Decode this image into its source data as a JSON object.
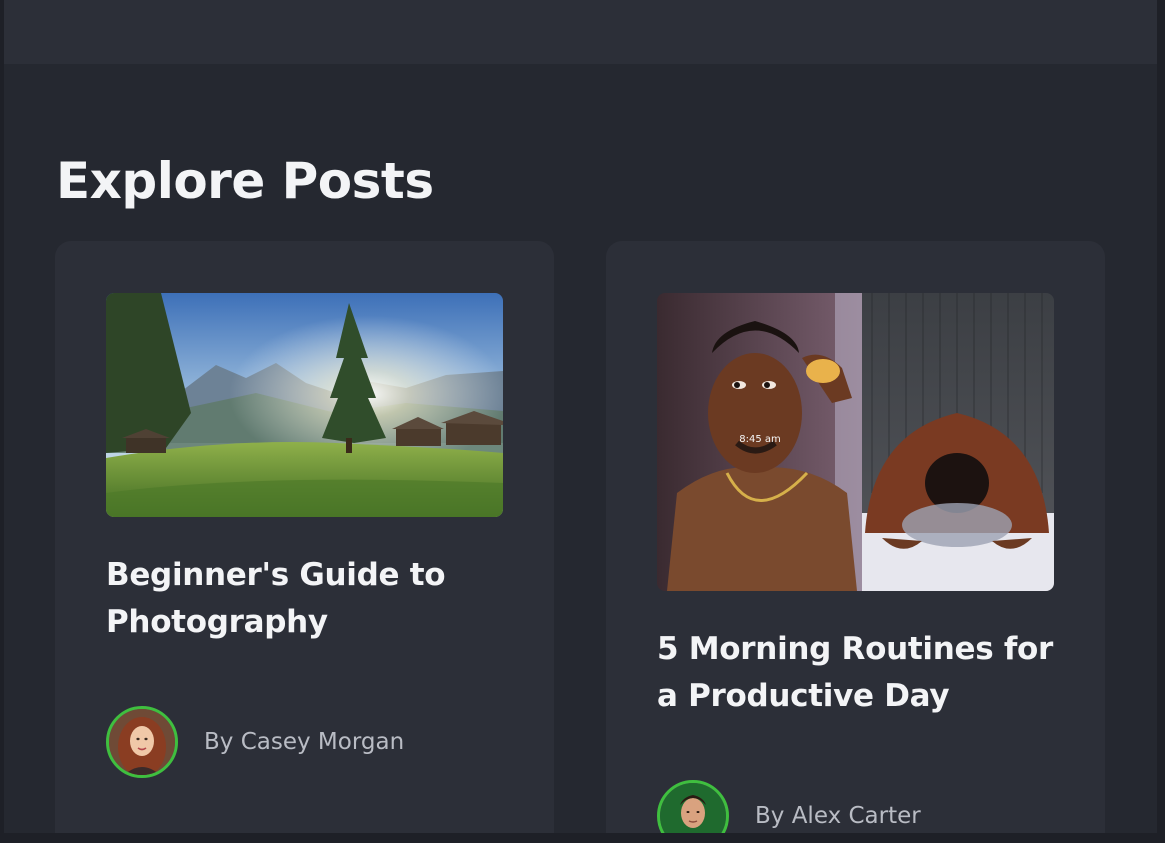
{
  "page": {
    "title": "Explore Posts"
  },
  "posts": [
    {
      "title": "Beginner's Guide to Photography",
      "image_alt": "Mountain meadow with a pine tree at sunrise",
      "author_prefix": "By",
      "author": "By Casey Morgan",
      "avatar_alt": "Casey Morgan"
    },
    {
      "title": "5 Morning Routines for a Productive Day",
      "image_alt": "Man doing a morning skincare routine",
      "author": "By Alex Carter",
      "avatar_alt": "Alex Carter",
      "image_caption": "8:45 am"
    }
  ],
  "colors": {
    "background": "#252830",
    "card": "#2c2f38",
    "avatar_ring": "#3fbf3f",
    "text": "#f3f4f6",
    "muted": "#b9bcc4"
  }
}
